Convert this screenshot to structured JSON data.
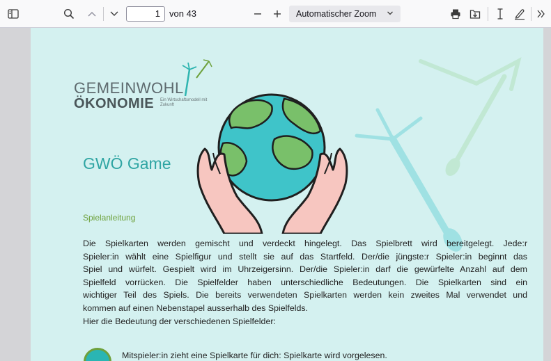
{
  "toolbar": {
    "page_current": "1",
    "page_total_label": "von 43",
    "zoom_label": "Automatischer Zoom"
  },
  "document": {
    "logo_line1": "GEMEINWOHL",
    "logo_line2": "ÖKONOMIE",
    "logo_tagline": "Ein Wirtschaftsmodell mit Zukunft",
    "title": "GWÖ Game",
    "section_heading": "Spielanleitung",
    "paragraph_lines": [
      "Die Spielkarten werden gemischt und verdeckt hingelegt. Das Spielbrett wird bereitgelegt. Jede:r",
      "Spieler:in wählt eine Spielfigur und stellt sie auf das Startfeld. Der/die jüngste:r Spieler:in beginnt das",
      "Spiel und würfelt. Gespielt wird im Uhrzeigersinn. Der/die Spieler:in darf die gewürfelte Anzahl auf dem",
      "Spielfeld vorrücken. Die Spielfelder haben unterschiedliche Bedeutungen. Die Spielkarten sind ein",
      "wichtiger Teil des Spiels. Die bereits verwendeten Spielkarten werden kein zweites Mal verwendet und",
      "kommen auf einen Nebenstapel ausserhalb des Spielfelds.",
      "Hier die Bedeutung der verschiedenen Spielfelder:"
    ],
    "field_item_text": "Mitspieler:in zieht eine Spielkarte für dich: Spielkarte wird vorgelesen."
  },
  "colors": {
    "page_background": "#d4f1f0",
    "title_color": "#2fa5a3",
    "heading_color": "#6ea13c",
    "earth_ocean": "#3fc4c9",
    "earth_land": "#79c06a",
    "hands": "#f7c6c0"
  },
  "icons": [
    "sidebar-toggle-icon",
    "search-icon",
    "chevron-up-icon",
    "chevron-down-icon",
    "minus-icon",
    "plus-icon",
    "print-icon",
    "save-icon",
    "text-cursor-icon",
    "draw-icon",
    "more-tools-icon"
  ]
}
